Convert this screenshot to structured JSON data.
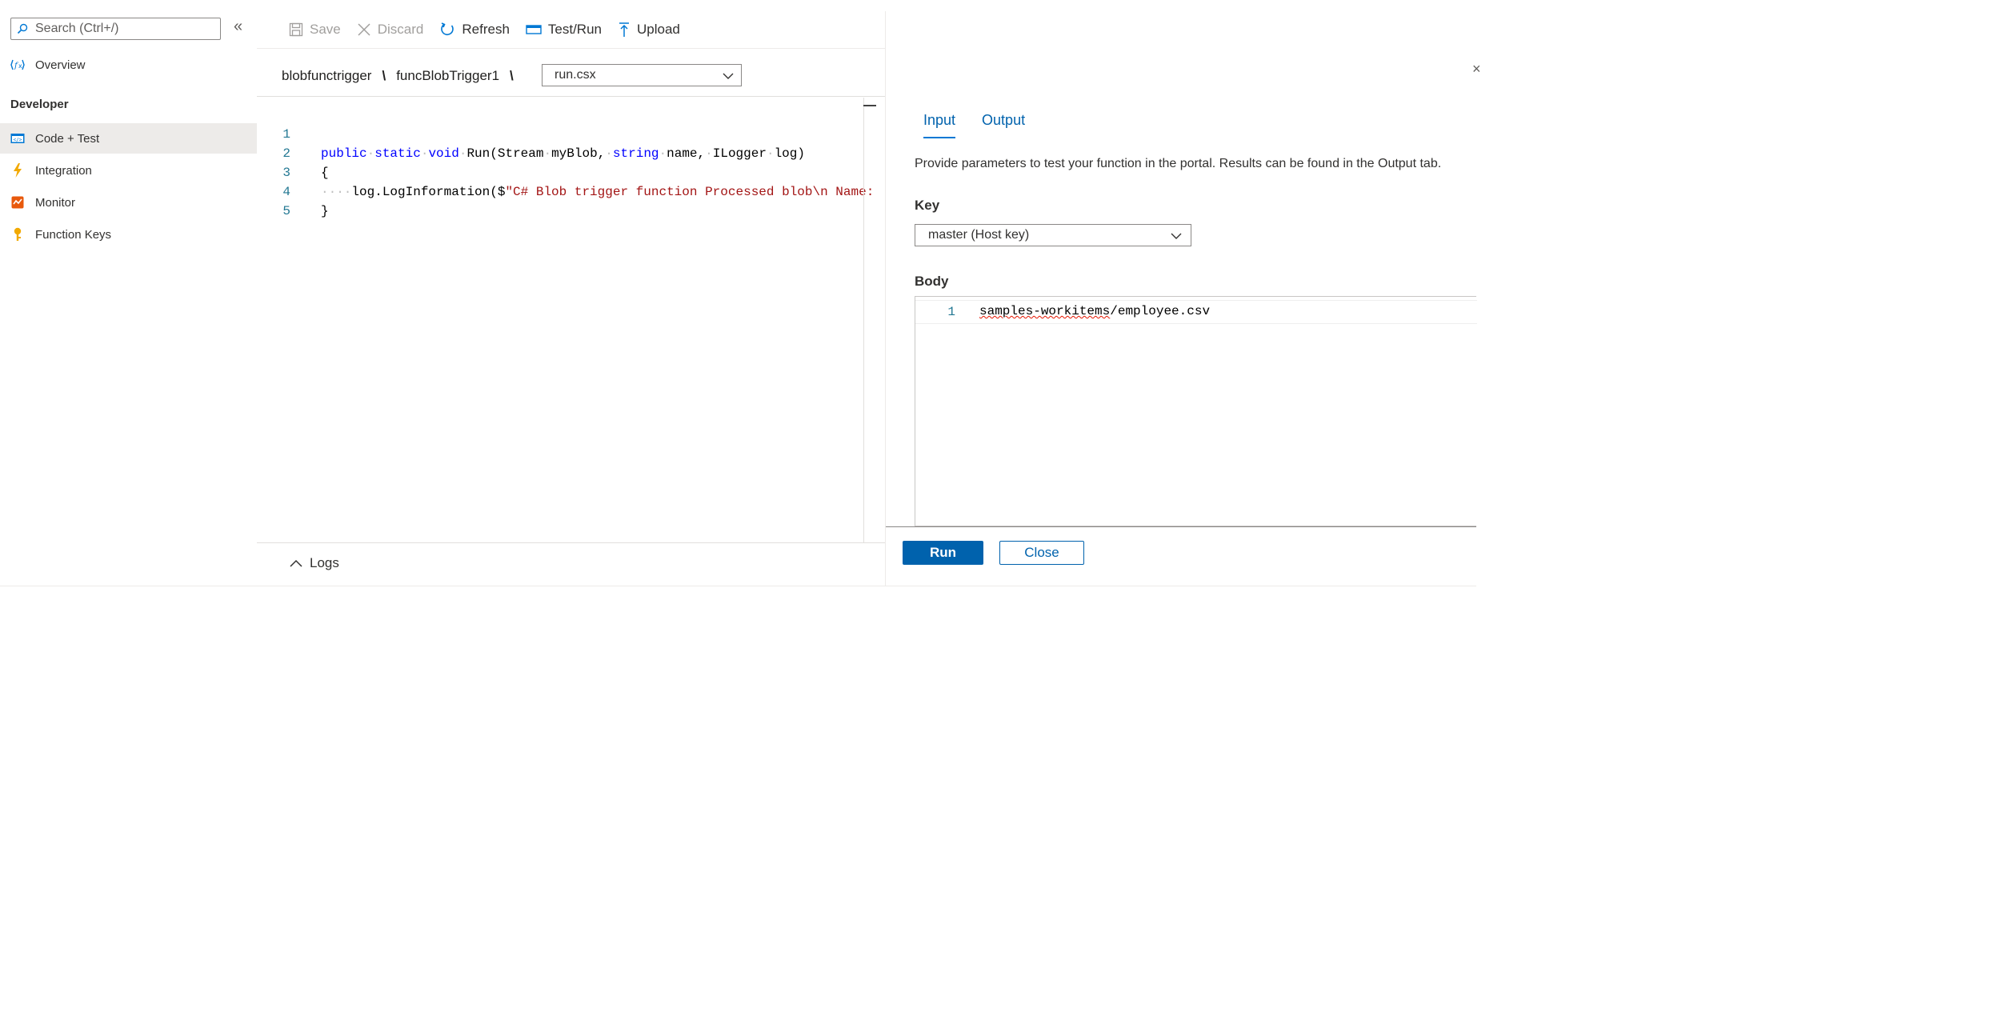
{
  "sidebar": {
    "search_placeholder": "Search (Ctrl+/)",
    "collapse_glyph": "«",
    "overview_label": "Overview",
    "section_developer": "Developer",
    "items": [
      {
        "label": "Code + Test",
        "icon": "code-icon",
        "active": true
      },
      {
        "label": "Integration",
        "icon": "lightning-icon",
        "active": false
      },
      {
        "label": "Monitor",
        "icon": "monitor-icon",
        "active": false
      },
      {
        "label": "Function Keys",
        "icon": "key-icon",
        "active": false
      }
    ]
  },
  "toolbar": {
    "save": "Save",
    "discard": "Discard",
    "refresh": "Refresh",
    "test_run": "Test/Run",
    "upload": "Upload"
  },
  "breadcrumb": {
    "app": "blobfunctrigger",
    "function": "funcBlobTrigger1",
    "separator": "\\"
  },
  "file_select": {
    "value": "run.csx"
  },
  "code": {
    "line_numbers": [
      "1",
      "2",
      "3",
      "4",
      "5"
    ],
    "l1_kw1": "public",
    "l1_kw2": "static",
    "l1_kw3": "void",
    "l1_rest1": "Run(Stream",
    "l1_rest2": "myBlob,",
    "l1_kw4": "string",
    "l1_rest3": "name,",
    "l1_rest4": "ILogger",
    "l1_rest5": "log)",
    "l2": "{",
    "l3_ident": "log.LogInformation($",
    "l3_str": "\"C# Blob trigger function Processed blob\\n Name:",
    "l4": "}"
  },
  "logs": {
    "label": "Logs"
  },
  "panel": {
    "close_glyph": "×",
    "tabs": [
      "Input",
      "Output"
    ],
    "description": "Provide parameters to test your function in the portal. Results can be found in the Output tab.",
    "key_label": "Key",
    "key_value": "master (Host key)",
    "body_label": "Body",
    "body_line_number": "1",
    "body_part1": "samples-workitems",
    "body_part2": "/employee.csv",
    "run_button": "Run",
    "close_button": "Close"
  },
  "colors": {
    "accent": "#0062ad",
    "keyword": "#0000ff",
    "string": "#a31515",
    "line_number": "#237893",
    "active_nav": "#edebe9"
  }
}
